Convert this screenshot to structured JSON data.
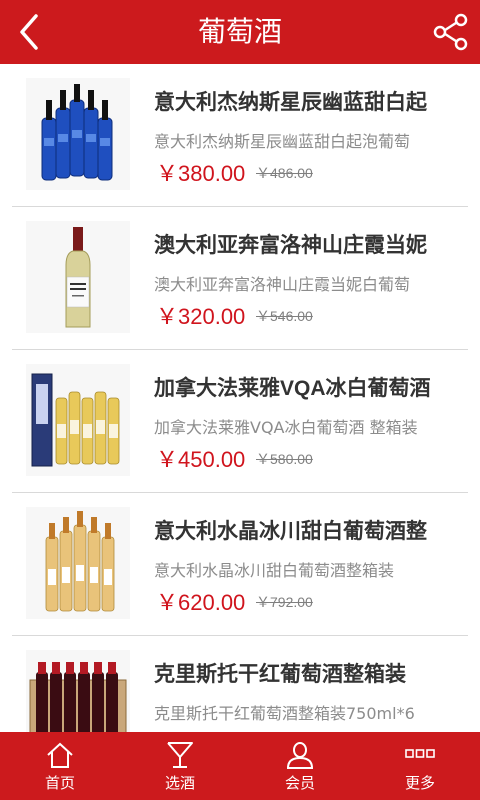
{
  "header": {
    "title": "葡萄酒",
    "back_icon": "back-arrow-icon",
    "share_icon": "share-icon",
    "bg_color": "#cc1a1d"
  },
  "products": [
    {
      "name": "意大利杰纳斯星辰幽蓝甜白起",
      "desc": "意大利杰纳斯星辰幽蓝甜白起泡葡萄",
      "price": "￥380.00",
      "old_price": "￥486.00"
    },
    {
      "name": "澳大利亚奔富洛神山庄霞当妮",
      "desc": "澳大利亚奔富洛神山庄霞当妮白葡萄",
      "price": "￥320.00",
      "old_price": "￥546.00"
    },
    {
      "name": "加拿大法莱雅VQA冰白葡萄酒",
      "desc": "加拿大法莱雅VQA冰白葡萄酒 整箱装",
      "price": "￥450.00",
      "old_price": "￥580.00"
    },
    {
      "name": "意大利水晶冰川甜白葡萄酒整",
      "desc": "意大利水晶冰川甜白葡萄酒整箱装",
      "price": "￥620.00",
      "old_price": "￥792.00"
    },
    {
      "name": "克里斯托干红葡萄酒整箱装",
      "desc": "克里斯托干红葡萄酒整箱装750ml*6",
      "price": "",
      "old_price": ""
    }
  ],
  "tabbar": {
    "items": [
      {
        "label": "首页",
        "icon": "home-icon"
      },
      {
        "label": "选酒",
        "icon": "wine-glass-icon"
      },
      {
        "label": "会员",
        "icon": "user-icon"
      },
      {
        "label": "更多",
        "icon": "more-icon"
      }
    ]
  },
  "colors": {
    "accent": "#cc1a1d",
    "price": "#d0141d",
    "divider": "#d9d9d9"
  }
}
